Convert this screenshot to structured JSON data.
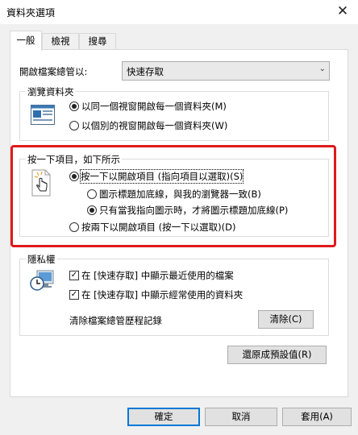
{
  "window": {
    "title": "資料夾選項",
    "close_glyph": "✕"
  },
  "tabs": [
    {
      "label": "一般",
      "active": true
    },
    {
      "label": "檢視",
      "active": false
    },
    {
      "label": "搜尋",
      "active": false
    }
  ],
  "open_explorer": {
    "label": "開啟檔案總管以:",
    "value": "快速存取"
  },
  "browse_folders": {
    "legend": "瀏覽資料夾",
    "options": [
      {
        "label": "以同一個視窗開啟每一個資料夾(M)",
        "selected": true
      },
      {
        "label": "以個別的視窗開啟每一個資料夾(W)",
        "selected": false
      }
    ]
  },
  "click_items": {
    "legend": "按一下項目，如下所示",
    "options": [
      {
        "label": "按一下以開啟項目 (指向項目以選取)(S)",
        "selected": true
      },
      {
        "label": "圖示標題加底線，與我的瀏覽器一致(B)",
        "selected": false
      },
      {
        "label": "只有當我指向圖示時，才將圖示標題加底線(P)",
        "selected": true
      },
      {
        "label": "按兩下以開啟項目 (按一下以選取)(D)",
        "selected": false
      }
    ]
  },
  "privacy": {
    "legend": "隱私權",
    "checks": [
      {
        "label": "在 [快速存取] 中顯示最近使用的檔案",
        "checked": true
      },
      {
        "label": "在 [快速存取] 中顯示經常使用的資料夾",
        "checked": true
      }
    ],
    "clear_label": "清除檔案總管歷程記錄",
    "clear_button": "清除(C)"
  },
  "restore_defaults": "還原成預設值(R)",
  "footer": {
    "ok": "確定",
    "cancel": "取消",
    "apply": "套用(A)"
  },
  "colors": {
    "highlight_box": "#e0191b",
    "primary_border": "#0078d7"
  }
}
